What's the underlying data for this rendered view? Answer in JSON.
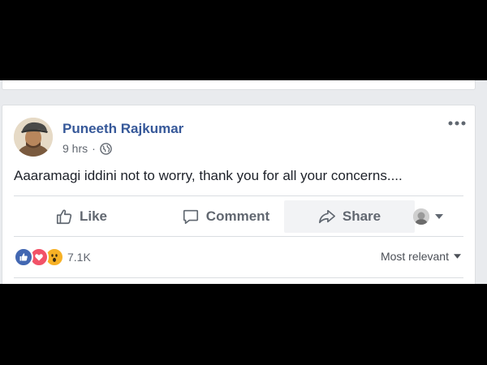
{
  "post": {
    "author": "Puneeth Rajkumar",
    "timestamp": "9 hrs",
    "separator": "·",
    "privacy_icon": "globe-icon",
    "text": "Aaaramagi iddini not to worry, thank you for all your concerns...."
  },
  "actions": {
    "like_label": "Like",
    "comment_label": "Comment",
    "share_label": "Share"
  },
  "reactions": {
    "types": [
      "like",
      "love",
      "wow"
    ],
    "count": "7.1K"
  },
  "comments": {
    "sort_label": "Most relevant"
  },
  "colors": {
    "link_blue": "#365899",
    "like_blue": "#4267b2",
    "love_red": "#f25268",
    "wow_yellow": "#f7b125",
    "secondary_text": "#616770",
    "page_bg": "#e9ebee"
  }
}
